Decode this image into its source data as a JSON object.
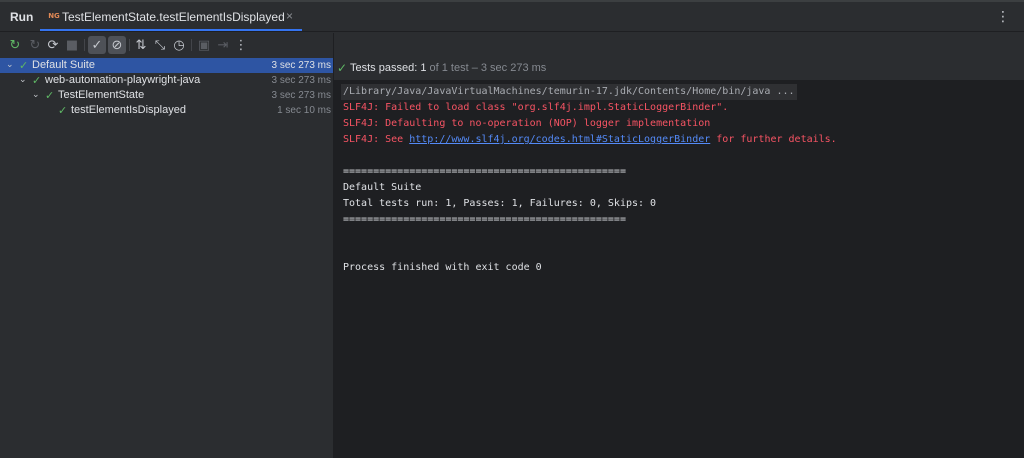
{
  "run_tab": {
    "label": "Run",
    "config_title": "TestElementState.testElementIsDisplayed",
    "close_glyph": "×",
    "more_glyph": "⋮"
  },
  "toolbar": {
    "icons": [
      "rerun-icon",
      "rerun-failed-icon",
      "toggle-auto-test-icon",
      "stop-icon",
      "show-passed-icon",
      "show-ignored-icon",
      "sort-alphabetically-icon",
      "sort-by-duration-icon",
      "test-history-icon",
      "export-icon",
      "import-icon",
      "more-icon"
    ]
  },
  "tree": [
    {
      "label": "Default Suite",
      "time": "3 sec 273 ms",
      "level": 0,
      "selected": true
    },
    {
      "label": "web-automation-playwright-java",
      "time": "3 sec 273 ms",
      "level": 1,
      "selected": false
    },
    {
      "label": "TestElementState",
      "time": "3 sec 273 ms",
      "level": 2,
      "selected": false
    },
    {
      "label": "testElementIsDisplayed",
      "time": "1 sec 10 ms",
      "level": 3,
      "selected": false
    }
  ],
  "status": {
    "passed_label": "Tests passed:",
    "passed_count": "1",
    "details": "of 1 test – 3 sec 273 ms"
  },
  "console": {
    "command": "/Library/Java/JavaVirtualMachines/temurin-17.jdk/Contents/Home/bin/java ...",
    "err1": "SLF4J: Failed to load class \"org.slf4j.impl.StaticLoggerBinder\".",
    "err2": "SLF4J: Defaulting to no-operation (NOP) logger implementation",
    "err3_prefix": "SLF4J: See ",
    "err3_link": "http://www.slf4j.org/codes.html#StaticLoggerBinder",
    "err3_suffix": " for further details.",
    "separator": "===============================================",
    "suite_name": "Default Suite",
    "summary": "Total tests run: 1, Passes: 1, Failures: 0, Skips: 0",
    "separator2": "===============================================",
    "exit": "Process finished with exit code 0"
  },
  "colors": {
    "accent": "#3574f0",
    "selection": "#2e55a3",
    "pass_green": "#5fb865",
    "error_red": "#f75464",
    "link_blue": "#548af7"
  }
}
